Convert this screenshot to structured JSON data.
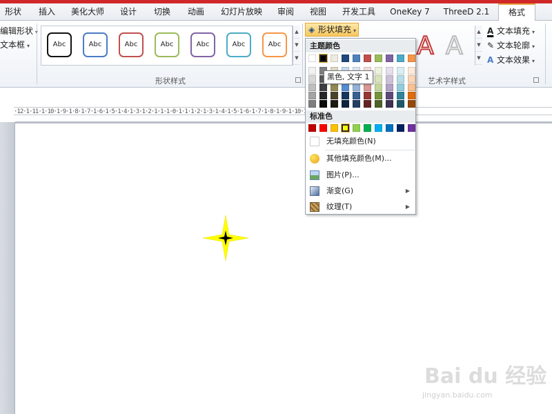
{
  "tabs": [
    "形状",
    "插入",
    "美化大师",
    "设计",
    "切换",
    "动画",
    "幻灯片放映",
    "审阅",
    "视图",
    "开发工具",
    "OneKey 7",
    "ThreeD 2.1",
    "格式"
  ],
  "active_tab": "格式",
  "ribbon": {
    "edit_shape": "编辑形状",
    "text_box": "文本框",
    "shape_styles_label": "形状样式",
    "style_sample": "Abc",
    "shape_fill_btn": "形状填充",
    "wordart_label": "艺术字样式",
    "text_fill": "文本填充",
    "text_outline": "文本轮廓",
    "text_effect": "文本效果"
  },
  "style_colors": [
    "#111111",
    "#4a7cc6",
    "#c0504d",
    "#9bbb59",
    "#8064a2",
    "#4bacc6",
    "#f79646"
  ],
  "ruler_text": "·12·1·11·1·10·1·9·1·8·1·7·1·6·1·5·1·4·1·3·1·2·1·1·1·0·1·1·1·2·1·3·1·4·1·5·1·6·1·7·1·8·1·9·1·10·1·11·1·12·",
  "dropdown": {
    "theme_colors_header": "主题颜色",
    "standard_colors_header": "标准色",
    "no_fill": "无填充颜色(N)",
    "more_colors": "其他填充颜色(M)...",
    "picture": "图片(P)...",
    "gradient": "渐变(G)",
    "texture": "纹理(T)",
    "tooltip": "黑色, 文字 1"
  },
  "theme_colors_top": [
    "#ffffff",
    "#000000",
    "#eeece1",
    "#1f497d",
    "#4f81bd",
    "#c0504d",
    "#9bbb59",
    "#8064a2",
    "#4bacc6",
    "#f79646"
  ],
  "theme_shades": [
    [
      "#f2f2f2",
      "#7f7f7f",
      "#ddd9c3",
      "#c6d9f0",
      "#dbe5f1",
      "#f2dcdb",
      "#ebf1dd",
      "#e5e0ec",
      "#dbeef3",
      "#fdeada"
    ],
    [
      "#d8d8d8",
      "#595959",
      "#c4bd97",
      "#8db3e2",
      "#b8cce4",
      "#e5b9b7",
      "#d7e3bc",
      "#ccc1d9",
      "#b7dde8",
      "#fbd5b5"
    ],
    [
      "#bfbfbf",
      "#3f3f3f",
      "#938953",
      "#548dd4",
      "#95b3d7",
      "#d99694",
      "#c3d69b",
      "#b2a2c7",
      "#92cddc",
      "#fac08f"
    ],
    [
      "#a5a5a5",
      "#262626",
      "#494429",
      "#17365d",
      "#366092",
      "#953734",
      "#76923c",
      "#5f497a",
      "#31859b",
      "#e36c09"
    ],
    [
      "#7f7f7f",
      "#0c0c0c",
      "#1d1b10",
      "#0f243e",
      "#244061",
      "#632423",
      "#4f6128",
      "#3f3151",
      "#205867",
      "#974806"
    ]
  ],
  "standard_colors": [
    "#c00000",
    "#ff0000",
    "#ffc000",
    "#ffff00",
    "#92d050",
    "#00b050",
    "#00b0f0",
    "#0070c0",
    "#002060",
    "#7030a0"
  ],
  "watermark": "Bai du 经验",
  "watermark_url": "jingyan.baidu.com"
}
